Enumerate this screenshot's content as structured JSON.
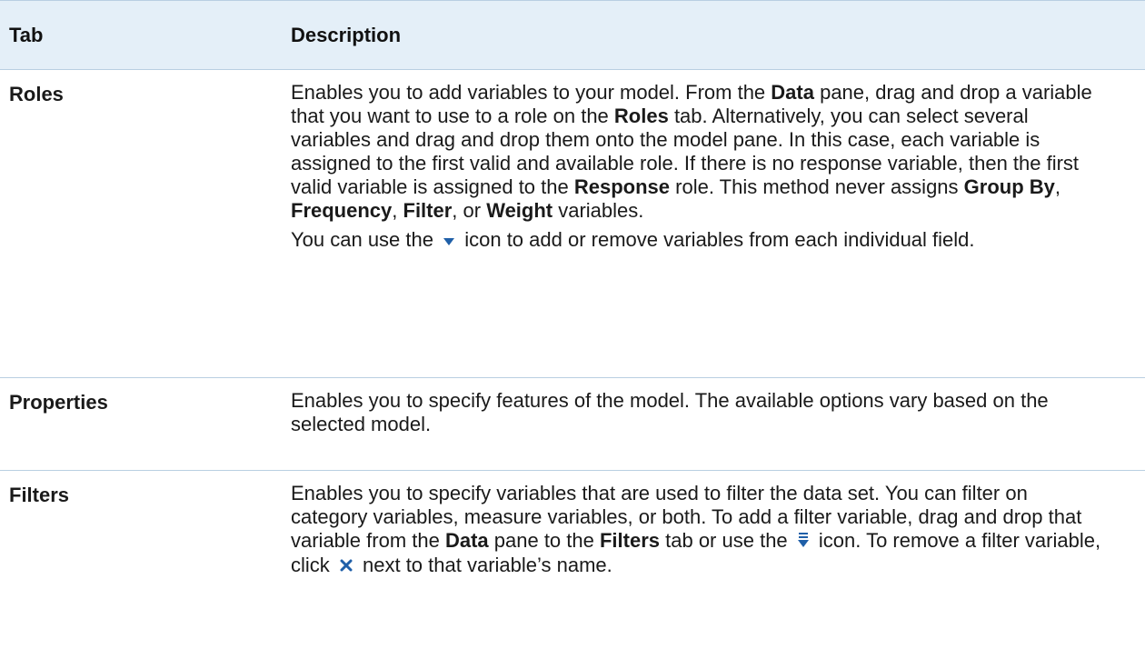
{
  "table": {
    "headers": {
      "tab": "Tab",
      "description": "Description"
    },
    "rows": [
      {
        "tab": "Roles",
        "p1": [
          "Enables you to add variables to your model. From the ",
          "Data",
          " pane, drag and drop a variable that you want to use to a role on the ",
          "Roles",
          " tab. Alternatively, you can select several variables and drag and drop them onto the model pane. In this case, each variable is assigned to the first valid and available role. If there is no response variable, then the first valid variable is assigned to the ",
          "Response",
          " role. This method never assigns ",
          "Group By",
          ", ",
          "Frequency",
          ", ",
          "Filter",
          ", or ",
          "Weight",
          " variables."
        ],
        "p2": [
          "You can use the ",
          " icon to add or remove variables from each individual field."
        ]
      },
      {
        "tab": "Properties",
        "p1": [
          "Enables you to specify features of the model. The available options vary based on the selected model."
        ]
      },
      {
        "tab": "Filters",
        "p1": [
          "Enables you to specify variables that are used to filter the data set. You can filter on category variables, measure variables, or both. To add a filter variable, drag and drop that variable from the ",
          "Data",
          " pane to the ",
          "Filters",
          " tab or use the ",
          " icon. To remove a filter variable, click ",
          " next to that variable’s name."
        ]
      }
    ]
  },
  "icons": {
    "dropdown": "dropdown-arrow-icon",
    "filter": "filter-dropdown-icon",
    "remove": "close-x-icon"
  },
  "colors": {
    "header_bg": "#e4eff8",
    "border": "#b9cfe2",
    "icon_blue": "#1f5fa8"
  }
}
